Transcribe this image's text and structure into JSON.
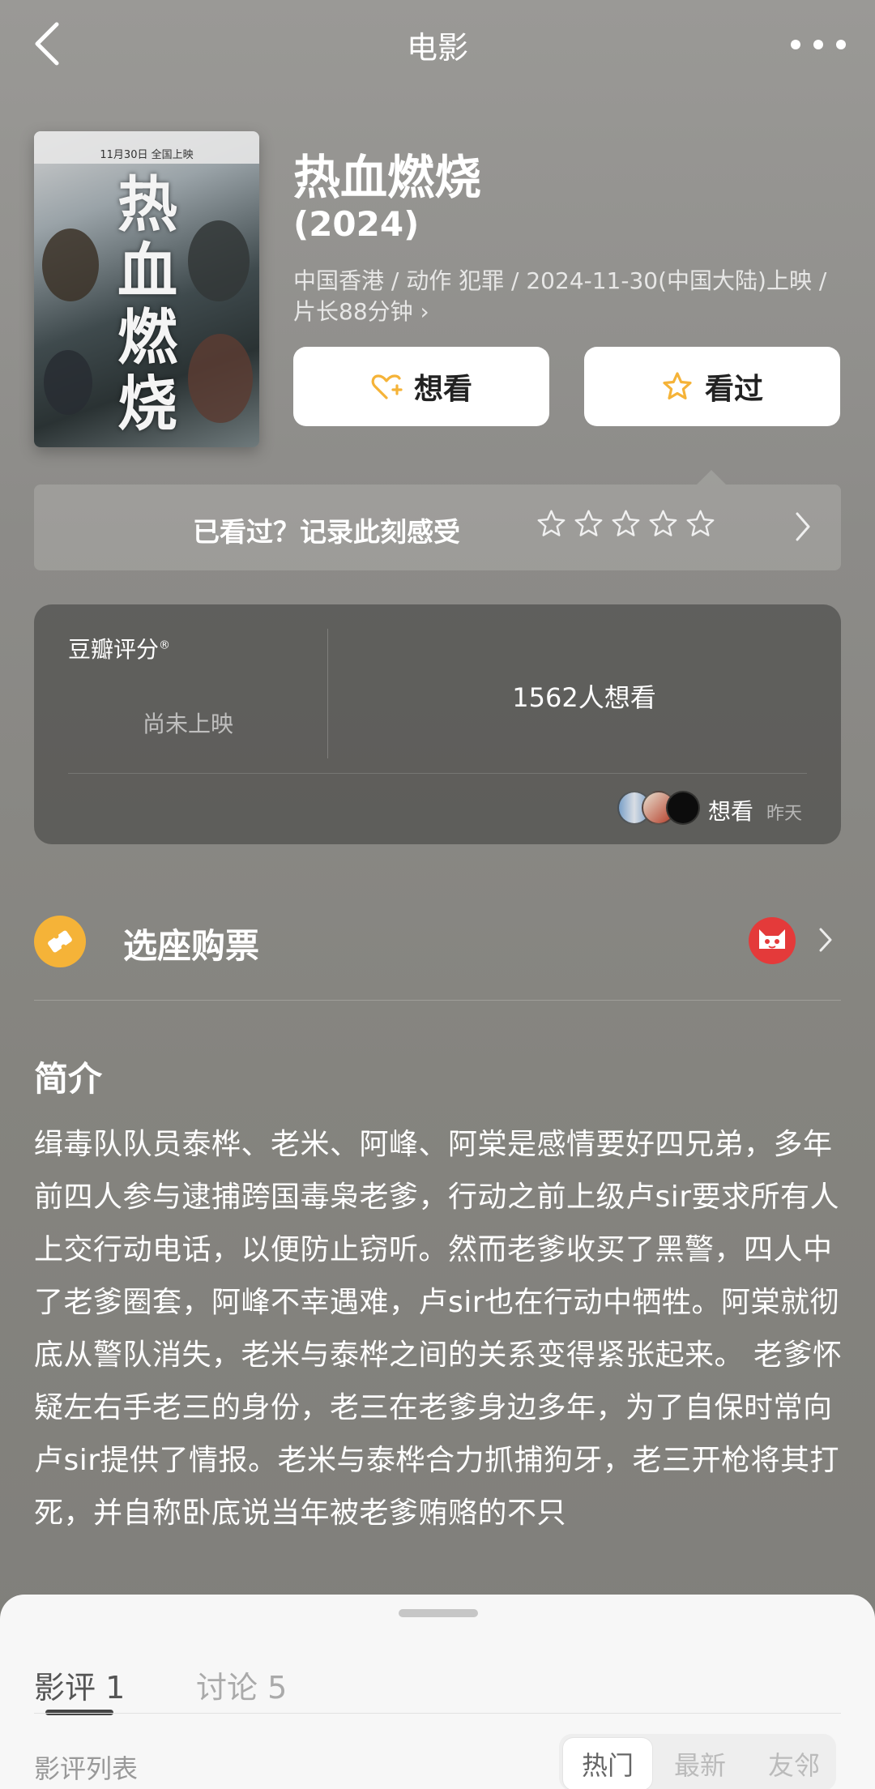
{
  "topbar": {
    "title": "电影"
  },
  "poster": {
    "release_note": "11月30日 全国上映",
    "glyphs": [
      "热",
      "血",
      "燃",
      "烧"
    ]
  },
  "movie": {
    "title": "热血燃烧",
    "year": "(2024)",
    "meta": "中国香港 / 动作 犯罪 / 2024-11-30(中国大陆)上映 / 片长88分钟 ›"
  },
  "actions": {
    "want_label": "想看",
    "seen_label": "看过"
  },
  "rate_prompt": {
    "text": "已看过？记录此刻感受",
    "stars": 5
  },
  "rating": {
    "label": "豆瓣评分",
    "mark": "®",
    "status": "尚未上映",
    "wish_count": "1562人想看",
    "activity_label": "想看",
    "activity_time": "昨天"
  },
  "tickets": {
    "label": "选座购票"
  },
  "synopsis": {
    "heading": "简介",
    "body": "缉毒队队员泰桦、老米、阿峰、阿棠是感情要好四兄弟，多年前四人参与逮捕跨国毒枭老爹，行动之前上级卢sir要求所有人上交行动电话，以便防止窃听。然而老爹收买了黑警，四人中了老爹圈套，阿峰不幸遇难，卢sir也在行动中牺牲。阿棠就彻底从警队消失，老米与泰桦之间的关系变得紧张起来。 老爹怀疑左右手老三的身份，老三在老爹身边多年，为了自保时常向卢sir提供了情报。老米与泰桦合力抓捕狗牙，老三开枪将其打死，并自称卧底说当年被老爹贿赂的不只"
  },
  "sheet": {
    "tabs": [
      {
        "label": "影评 1"
      },
      {
        "label": "讨论 5"
      }
    ],
    "list_title": "影评列表",
    "filters": [
      "热门",
      "最新",
      "友邻"
    ]
  },
  "colors": {
    "accent": "#f5b338",
    "maoyan": "#e43a3a",
    "sheet_bg": "#f7f7f7"
  }
}
